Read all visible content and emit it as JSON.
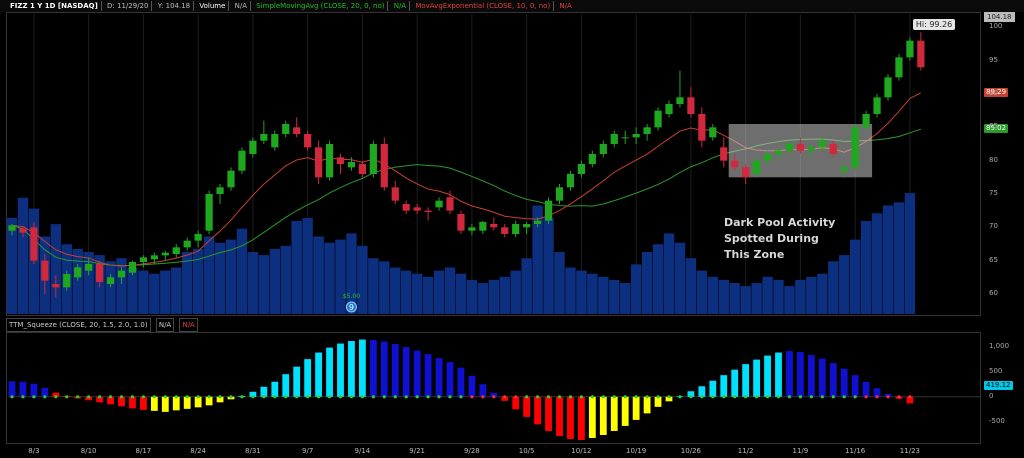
{
  "header": {
    "symbol": "FIZZ 1 Y 1D [NASDAQ]",
    "date": "D: 11/29/20",
    "last": "Y: 104.18",
    "volume": "Volume",
    "volume_value": "N/A",
    "sma": "SimpleMovingAvg (CLOSE, 20, 0, no)",
    "sma_value": "N/A",
    "ema": "MovAvgExponential (CLOSE, 10, 0, no)",
    "ema_value": "N/A"
  },
  "oscillator_header": {
    "study": "TTM_Squeeze (CLOSE, 20, 1.5, 2.0, 1.0)",
    "value1": "N/A",
    "value2": "N/A"
  },
  "labels": {
    "last_price_tag": "104.18",
    "high_tag": "Hi: 99.26",
    "ema_tag": "89.29",
    "sma_tag": "85.02",
    "osc_tag": "419.12",
    "annotation_line1": "Dark Pool Activity",
    "annotation_line2": "Spotted During",
    "annotation_line3": "This Zone",
    "event_marker": "9",
    "event_amount": "$5.00"
  },
  "colors": {
    "up": "#1fa81f",
    "down": "#d0283c",
    "volume": "#0d2f80",
    "sma": "#2a9a2a",
    "ema": "#c84030",
    "zone": "#c8c8c8",
    "hist_cyan": "#00e0ff",
    "hist_blue": "#1010d0",
    "hist_red": "#ff0000",
    "hist_yellow": "#ffff00",
    "dot_green": "#30d030",
    "dot_red": "#ff3030"
  },
  "chart_data": [
    {
      "type": "candlestick",
      "title": "FIZZ 1 Y 1D [NASDAQ]",
      "ylim": [
        57,
        102
      ],
      "yticks": [
        60,
        65,
        70,
        75,
        80,
        85,
        90,
        95,
        100
      ],
      "xticks": [
        "8/3",
        "8/10",
        "8/17",
        "8/24",
        "8/31",
        "9/7",
        "9/14",
        "9/21",
        "9/28",
        "10/5",
        "10/12",
        "10/19",
        "10/26",
        "11/2",
        "11/9",
        "11/16",
        "11/23"
      ],
      "xtick_bars": [
        2,
        7,
        12,
        17,
        22,
        27,
        32,
        37,
        42,
        47,
        52,
        57,
        62,
        67,
        72,
        77,
        82
      ],
      "candles": [
        {
          "o": 69.5,
          "h": 70.5,
          "l": 68.8,
          "c": 70.3
        },
        {
          "o": 69.8,
          "h": 70.2,
          "l": 68.5,
          "c": 69.2
        },
        {
          "o": 70.0,
          "h": 70.8,
          "l": 64.5,
          "c": 65.0
        },
        {
          "o": 65.0,
          "h": 66.0,
          "l": 60.0,
          "c": 62.0
        },
        {
          "o": 61.5,
          "h": 62.8,
          "l": 59.5,
          "c": 61.0
        },
        {
          "o": 61.0,
          "h": 63.5,
          "l": 60.5,
          "c": 63.0
        },
        {
          "o": 62.5,
          "h": 64.5,
          "l": 62.0,
          "c": 64.0
        },
        {
          "o": 63.5,
          "h": 65.5,
          "l": 62.8,
          "c": 64.5
        },
        {
          "o": 64.5,
          "h": 65.0,
          "l": 61.0,
          "c": 61.8
        },
        {
          "o": 61.5,
          "h": 63.0,
          "l": 61.0,
          "c": 62.5
        },
        {
          "o": 62.5,
          "h": 64.0,
          "l": 61.5,
          "c": 63.5
        },
        {
          "o": 63.2,
          "h": 65.0,
          "l": 62.8,
          "c": 64.8
        },
        {
          "o": 64.8,
          "h": 65.8,
          "l": 64.0,
          "c": 65.5
        },
        {
          "o": 65.2,
          "h": 66.2,
          "l": 64.5,
          "c": 65.8
        },
        {
          "o": 65.8,
          "h": 66.5,
          "l": 65.0,
          "c": 66.2
        },
        {
          "o": 66.0,
          "h": 67.5,
          "l": 65.5,
          "c": 67.0
        },
        {
          "o": 67.0,
          "h": 68.5,
          "l": 66.5,
          "c": 68.0
        },
        {
          "o": 68.0,
          "h": 69.5,
          "l": 67.0,
          "c": 69.0
        },
        {
          "o": 69.5,
          "h": 75.5,
          "l": 69.0,
          "c": 75.0
        },
        {
          "o": 75.0,
          "h": 76.5,
          "l": 73.5,
          "c": 76.0
        },
        {
          "o": 76.0,
          "h": 79.0,
          "l": 75.5,
          "c": 78.5
        },
        {
          "o": 78.5,
          "h": 82.0,
          "l": 78.0,
          "c": 81.5
        },
        {
          "o": 81.0,
          "h": 83.5,
          "l": 80.5,
          "c": 83.0
        },
        {
          "o": 83.0,
          "h": 86.0,
          "l": 82.5,
          "c": 84.0
        },
        {
          "o": 82.0,
          "h": 84.5,
          "l": 81.5,
          "c": 84.0
        },
        {
          "o": 84.0,
          "h": 86.0,
          "l": 83.5,
          "c": 85.5
        },
        {
          "o": 85.0,
          "h": 86.5,
          "l": 83.5,
          "c": 84.0
        },
        {
          "o": 84.0,
          "h": 84.5,
          "l": 81.5,
          "c": 82.0
        },
        {
          "o": 82.0,
          "h": 83.0,
          "l": 76.5,
          "c": 77.5
        },
        {
          "o": 77.5,
          "h": 83.0,
          "l": 77.0,
          "c": 82.5
        },
        {
          "o": 80.5,
          "h": 81.0,
          "l": 78.0,
          "c": 79.5
        },
        {
          "o": 79.0,
          "h": 80.5,
          "l": 78.5,
          "c": 79.8
        },
        {
          "o": 79.5,
          "h": 80.0,
          "l": 77.5,
          "c": 78.0
        },
        {
          "o": 78.0,
          "h": 83.0,
          "l": 77.5,
          "c": 82.5
        },
        {
          "o": 82.5,
          "h": 83.5,
          "l": 75.5,
          "c": 76.0
        },
        {
          "o": 76.0,
          "h": 77.0,
          "l": 73.5,
          "c": 74.0
        },
        {
          "o": 73.5,
          "h": 74.0,
          "l": 72.0,
          "c": 72.5
        },
        {
          "o": 73.0,
          "h": 73.5,
          "l": 72.0,
          "c": 72.5
        },
        {
          "o": 72.5,
          "h": 73.0,
          "l": 71.0,
          "c": 72.3
        },
        {
          "o": 73.0,
          "h": 74.5,
          "l": 72.5,
          "c": 74.0
        },
        {
          "o": 74.5,
          "h": 75.5,
          "l": 72.0,
          "c": 72.5
        },
        {
          "o": 72.0,
          "h": 72.5,
          "l": 69.0,
          "c": 69.5
        },
        {
          "o": 69.5,
          "h": 70.5,
          "l": 68.8,
          "c": 70.0
        },
        {
          "o": 69.5,
          "h": 71.0,
          "l": 69.0,
          "c": 70.8
        },
        {
          "o": 70.5,
          "h": 71.5,
          "l": 69.5,
          "c": 70.0
        },
        {
          "o": 70.0,
          "h": 70.5,
          "l": 68.5,
          "c": 69.0
        },
        {
          "o": 69.0,
          "h": 71.0,
          "l": 68.5,
          "c": 70.5
        },
        {
          "o": 70.0,
          "h": 70.8,
          "l": 69.0,
          "c": 70.5
        },
        {
          "o": 70.5,
          "h": 71.5,
          "l": 70.0,
          "c": 71.0
        },
        {
          "o": 71.0,
          "h": 74.5,
          "l": 70.5,
          "c": 74.0
        },
        {
          "o": 74.0,
          "h": 76.5,
          "l": 73.5,
          "c": 76.0
        },
        {
          "o": 76.0,
          "h": 78.5,
          "l": 75.5,
          "c": 78.0
        },
        {
          "o": 78.0,
          "h": 80.0,
          "l": 77.5,
          "c": 79.5
        },
        {
          "o": 79.5,
          "h": 81.5,
          "l": 79.0,
          "c": 81.0
        },
        {
          "o": 81.0,
          "h": 83.0,
          "l": 80.5,
          "c": 82.5
        },
        {
          "o": 82.5,
          "h": 84.5,
          "l": 82.0,
          "c": 84.0
        },
        {
          "o": 83.5,
          "h": 84.5,
          "l": 82.5,
          "c": 83.5
        },
        {
          "o": 83.5,
          "h": 85.0,
          "l": 82.5,
          "c": 84.0
        },
        {
          "o": 84.0,
          "h": 85.5,
          "l": 83.0,
          "c": 85.0
        },
        {
          "o": 85.0,
          "h": 88.0,
          "l": 84.5,
          "c": 87.5
        },
        {
          "o": 87.0,
          "h": 89.0,
          "l": 86.5,
          "c": 88.5
        },
        {
          "o": 88.5,
          "h": 93.5,
          "l": 88.0,
          "c": 89.5
        },
        {
          "o": 89.5,
          "h": 91.0,
          "l": 86.5,
          "c": 87.0
        },
        {
          "o": 87.0,
          "h": 88.0,
          "l": 82.0,
          "c": 83.0
        },
        {
          "o": 83.5,
          "h": 85.5,
          "l": 83.0,
          "c": 85.0
        },
        {
          "o": 82.0,
          "h": 83.5,
          "l": 79.0,
          "c": 80.0
        },
        {
          "o": 80.0,
          "h": 81.0,
          "l": 78.5,
          "c": 79.0
        },
        {
          "o": 79.0,
          "h": 79.5,
          "l": 76.5,
          "c": 77.5
        },
        {
          "o": 78.0,
          "h": 80.5,
          "l": 77.5,
          "c": 80.0
        },
        {
          "o": 80.0,
          "h": 81.5,
          "l": 79.5,
          "c": 81.0
        },
        {
          "o": 81.0,
          "h": 82.0,
          "l": 80.0,
          "c": 81.5
        },
        {
          "o": 81.5,
          "h": 83.0,
          "l": 81.0,
          "c": 82.5
        },
        {
          "o": 82.5,
          "h": 83.5,
          "l": 81.0,
          "c": 81.5
        },
        {
          "o": 81.5,
          "h": 82.5,
          "l": 80.5,
          "c": 82.0
        },
        {
          "o": 82.0,
          "h": 83.5,
          "l": 81.5,
          "c": 83.0
        },
        {
          "o": 82.5,
          "h": 83.0,
          "l": 80.5,
          "c": 81.0
        },
        {
          "o": 78.5,
          "h": 79.5,
          "l": 77.5,
          "c": 79.0
        },
        {
          "o": 79.0,
          "h": 85.5,
          "l": 78.5,
          "c": 85.0
        },
        {
          "o": 85.0,
          "h": 87.5,
          "l": 84.5,
          "c": 87.0
        },
        {
          "o": 87.0,
          "h": 90.0,
          "l": 86.5,
          "c": 89.5
        },
        {
          "o": 89.5,
          "h": 93.0,
          "l": 89.0,
          "c": 92.5
        },
        {
          "o": 92.5,
          "h": 96.0,
          "l": 92.0,
          "c": 95.5
        },
        {
          "o": 95.5,
          "h": 98.5,
          "l": 95.0,
          "c": 98.0
        },
        {
          "o": 98.0,
          "h": 99.26,
          "l": 93.5,
          "c": 94.0
        }
      ],
      "volume": [
        70,
        70,
        62,
        52,
        48,
        44,
        40,
        38,
        36,
        34,
        34,
        34,
        34,
        34,
        34,
        34,
        34,
        34,
        34,
        38,
        38,
        40,
        40,
        42,
        44,
        44,
        46,
        46,
        48,
        48,
        50,
        52,
        52,
        50,
        50,
        48,
        46,
        44,
        42,
        40,
        38,
        36,
        34,
        34,
        34,
        34,
        34,
        34,
        36,
        40,
        44,
        48,
        52,
        58,
        62,
        66,
        68,
        70,
        70,
        70,
        70,
        68,
        62,
        58,
        55,
        52,
        50,
        48,
        46,
        44,
        42,
        40,
        40,
        40,
        42,
        44,
        46,
        48,
        50,
        52,
        54,
        56,
        58
      ],
      "volume_bars": [
        62,
        75,
        68,
        50,
        58,
        45,
        42,
        40,
        38,
        34,
        36,
        30,
        28,
        26,
        28,
        30,
        40,
        42,
        50,
        46,
        48,
        55,
        40,
        38,
        42,
        44,
        60,
        62,
        50,
        46,
        48,
        52,
        44,
        36,
        34,
        30,
        28,
        26,
        24,
        28,
        30,
        26,
        22,
        20,
        22,
        24,
        28,
        36,
        70,
        62,
        40,
        30,
        28,
        26,
        24,
        22,
        20,
        32,
        40,
        45,
        52,
        46,
        36,
        28,
        24,
        22,
        20,
        18,
        20,
        24,
        22,
        18,
        22,
        24,
        26,
        34,
        38,
        48,
        60,
        65,
        70,
        72,
        78
      ],
      "sma_ema_note": "SimpleMovingAvg 20 (green) and MovAvgExponential 10 (red) overlays"
    },
    {
      "type": "bar",
      "title": "TTM_Squeeze (CLOSE, 20, 1.5, 2.0, 1.0)",
      "ylim": [
        -900,
        1250
      ],
      "yticks": [
        1000,
        500,
        0,
        -500
      ],
      "values": [
        310,
        300,
        260,
        180,
        80,
        20,
        -30,
        -70,
        -110,
        -150,
        -190,
        -230,
        -260,
        -280,
        -300,
        -270,
        -240,
        -210,
        -170,
        -110,
        -50,
        20,
        100,
        200,
        300,
        450,
        600,
        750,
        880,
        980,
        1060,
        1110,
        1140,
        1130,
        1100,
        1050,
        990,
        920,
        850,
        770,
        690,
        580,
        420,
        250,
        80,
        -80,
        -250,
        -400,
        -550,
        -680,
        -780,
        -840,
        -860,
        -820,
        -760,
        -680,
        -580,
        -460,
        -330,
        -200,
        -90,
        10,
        110,
        210,
        320,
        430,
        540,
        650,
        740,
        820,
        880,
        910,
        890,
        830,
        760,
        670,
        560,
        430,
        300,
        170,
        60,
        -40,
        -130
      ],
      "bar_colors": [
        "blue",
        "blue",
        "blue",
        "blue",
        "red",
        "red",
        "red",
        "red",
        "red",
        "red",
        "red",
        "red",
        "red",
        "yellow",
        "yellow",
        "yellow",
        "yellow",
        "yellow",
        "yellow",
        "yellow",
        "yellow",
        "cyan",
        "cyan",
        "cyan",
        "cyan",
        "cyan",
        "cyan",
        "cyan",
        "cyan",
        "cyan",
        "cyan",
        "cyan",
        "cyan",
        "blue",
        "blue",
        "blue",
        "blue",
        "blue",
        "blue",
        "blue",
        "blue",
        "blue",
        "blue",
        "blue",
        "blue",
        "red",
        "red",
        "red",
        "red",
        "red",
        "red",
        "red",
        "red",
        "yellow",
        "yellow",
        "yellow",
        "yellow",
        "yellow",
        "yellow",
        "yellow",
        "yellow",
        "cyan",
        "cyan",
        "cyan",
        "cyan",
        "cyan",
        "cyan",
        "cyan",
        "cyan",
        "cyan",
        "cyan",
        "blue",
        "blue",
        "blue",
        "blue",
        "blue",
        "blue",
        "blue",
        "blue",
        "blue",
        "blue",
        "red",
        "red"
      ],
      "dots": "zero-line squeeze dots, green (off) / red (on)"
    }
  ]
}
